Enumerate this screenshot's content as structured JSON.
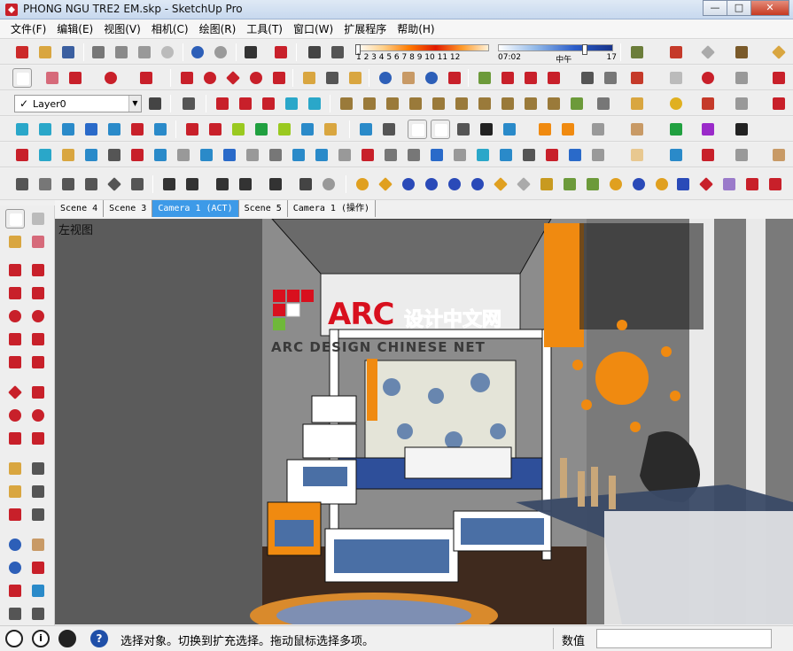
{
  "window": {
    "title": "PHONG NGU TRE2 EM.skp - SketchUp Pro",
    "minimize": "—",
    "maximize": "□",
    "close": "✕"
  },
  "menu": [
    "文件(F)",
    "编辑(E)",
    "视图(V)",
    "相机(C)",
    "绘图(R)",
    "工具(T)",
    "窗口(W)",
    "扩展程序",
    "帮助(H)"
  ],
  "layer": {
    "name": "Layer0",
    "check": "✓",
    "arrow": "▼"
  },
  "shadow": {
    "months": "1 2 3 4 5 6 7 8 9 10 11 12",
    "time_start": "07:02",
    "time_mid": "中午",
    "time_end": "17"
  },
  "scene_tabs": [
    "Scene 4",
    "Scene 3",
    "Camera 1 (ACT)",
    "Scene 5",
    "Camera 1 (操作)"
  ],
  "active_tab_index": 2,
  "viewport": {
    "view_label": "左视图"
  },
  "brand": {
    "logo": "ARC",
    "cn": "设计中文网",
    "en": "ARC DESIGN CHINESE NET"
  },
  "status": {
    "message": "选择对象。切换到扩充选择。拖动鼠标选择多项。",
    "value_label": "数值",
    "value": "",
    "help_icon": "?",
    "info_icon": "i"
  },
  "colors": {
    "accent_tab": "#3d9ae8",
    "logo_red": "#d8101e"
  }
}
